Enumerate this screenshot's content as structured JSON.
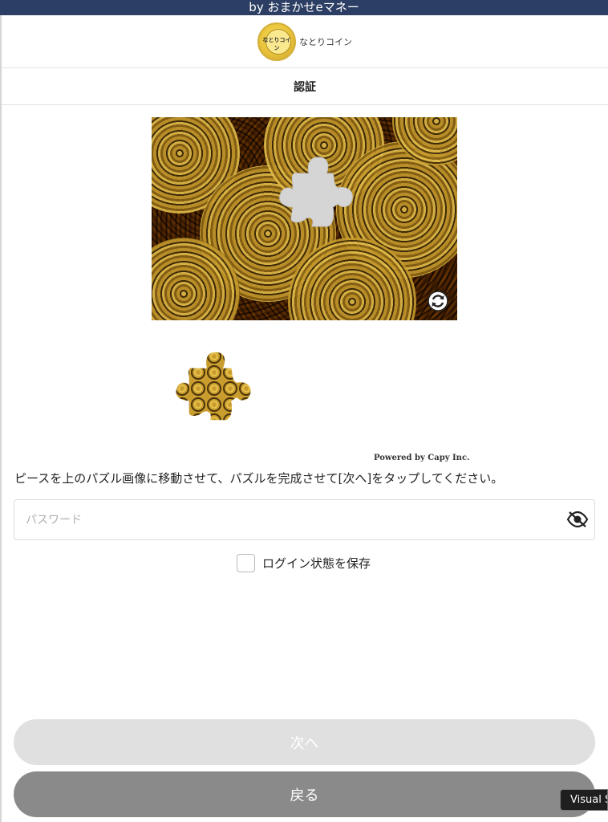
{
  "topbar": {
    "text": "by おまかせeマネー"
  },
  "header": {
    "logo_text": "なとりコイン",
    "brand": "なとりコイン"
  },
  "title": "認証",
  "captcha": {
    "refresh_icon": "refresh-icon",
    "powered_by": "Powered by Capy Inc."
  },
  "instruction": "ピースを上のパズル画像に移動させて、パズルを完成させて[次へ]をタップしてください。",
  "password": {
    "placeholder": "パスワード",
    "value": "",
    "toggle_icon": "eye-slash-icon"
  },
  "remember": {
    "label": "ログイン状態を保存",
    "checked": false
  },
  "buttons": {
    "next": "次へ",
    "back": "戻る"
  },
  "tooltip": "Visual S",
  "colors": {
    "topbar": "#2c3e63",
    "next_button": "#e0e0e0",
    "back_button": "#8a8a8a",
    "hole": "#d5d5d5"
  }
}
